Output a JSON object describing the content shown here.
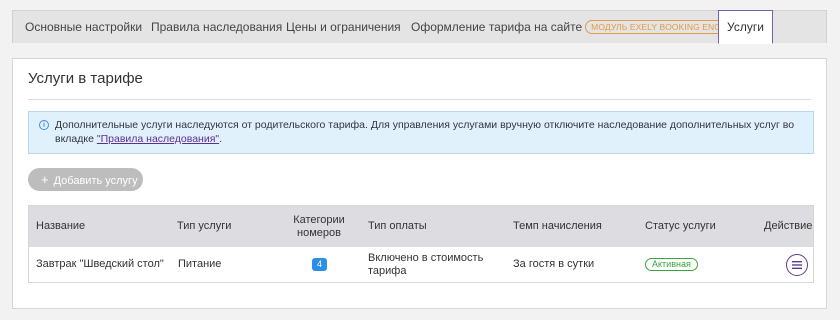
{
  "tabs": [
    {
      "label": "Основные настройки"
    },
    {
      "label": "Правила наследования"
    },
    {
      "label": "Цены и ограничения"
    },
    {
      "label": "Оформление тарифа на сайте",
      "badge": "МОДУЛЬ EXELY BOOKING ENGINE"
    },
    {
      "label": "Услуги",
      "active": true
    }
  ],
  "panel": {
    "title": "Услуги в тарифе",
    "info_text": "Дополнительные услуги наследуются от родительского тарифа. Для управления услугами вручную отключите наследование дополнительных услуг во вкладке ",
    "info_link": "\"Правила наследования\"",
    "info_end": ".",
    "add_button": "Добавить услугу"
  },
  "table": {
    "headers": [
      "Название",
      "Тип услуги",
      "Категории номеров",
      "Тип оплаты",
      "Темп начисления",
      "Статус услуги",
      "Действие"
    ],
    "rows": [
      {
        "name": "Завтрак \"Шведский стол\"",
        "type": "Питание",
        "categories": "4",
        "payment": "Включено в стоимость тарифа",
        "rate": "За гостя в сутки",
        "status": "Активная"
      }
    ]
  },
  "colors": {
    "accent": "#5d3b8f",
    "badge_blue": "#2b8fe6",
    "status_green": "#3aa53a",
    "module_orange": "#e39a49"
  }
}
